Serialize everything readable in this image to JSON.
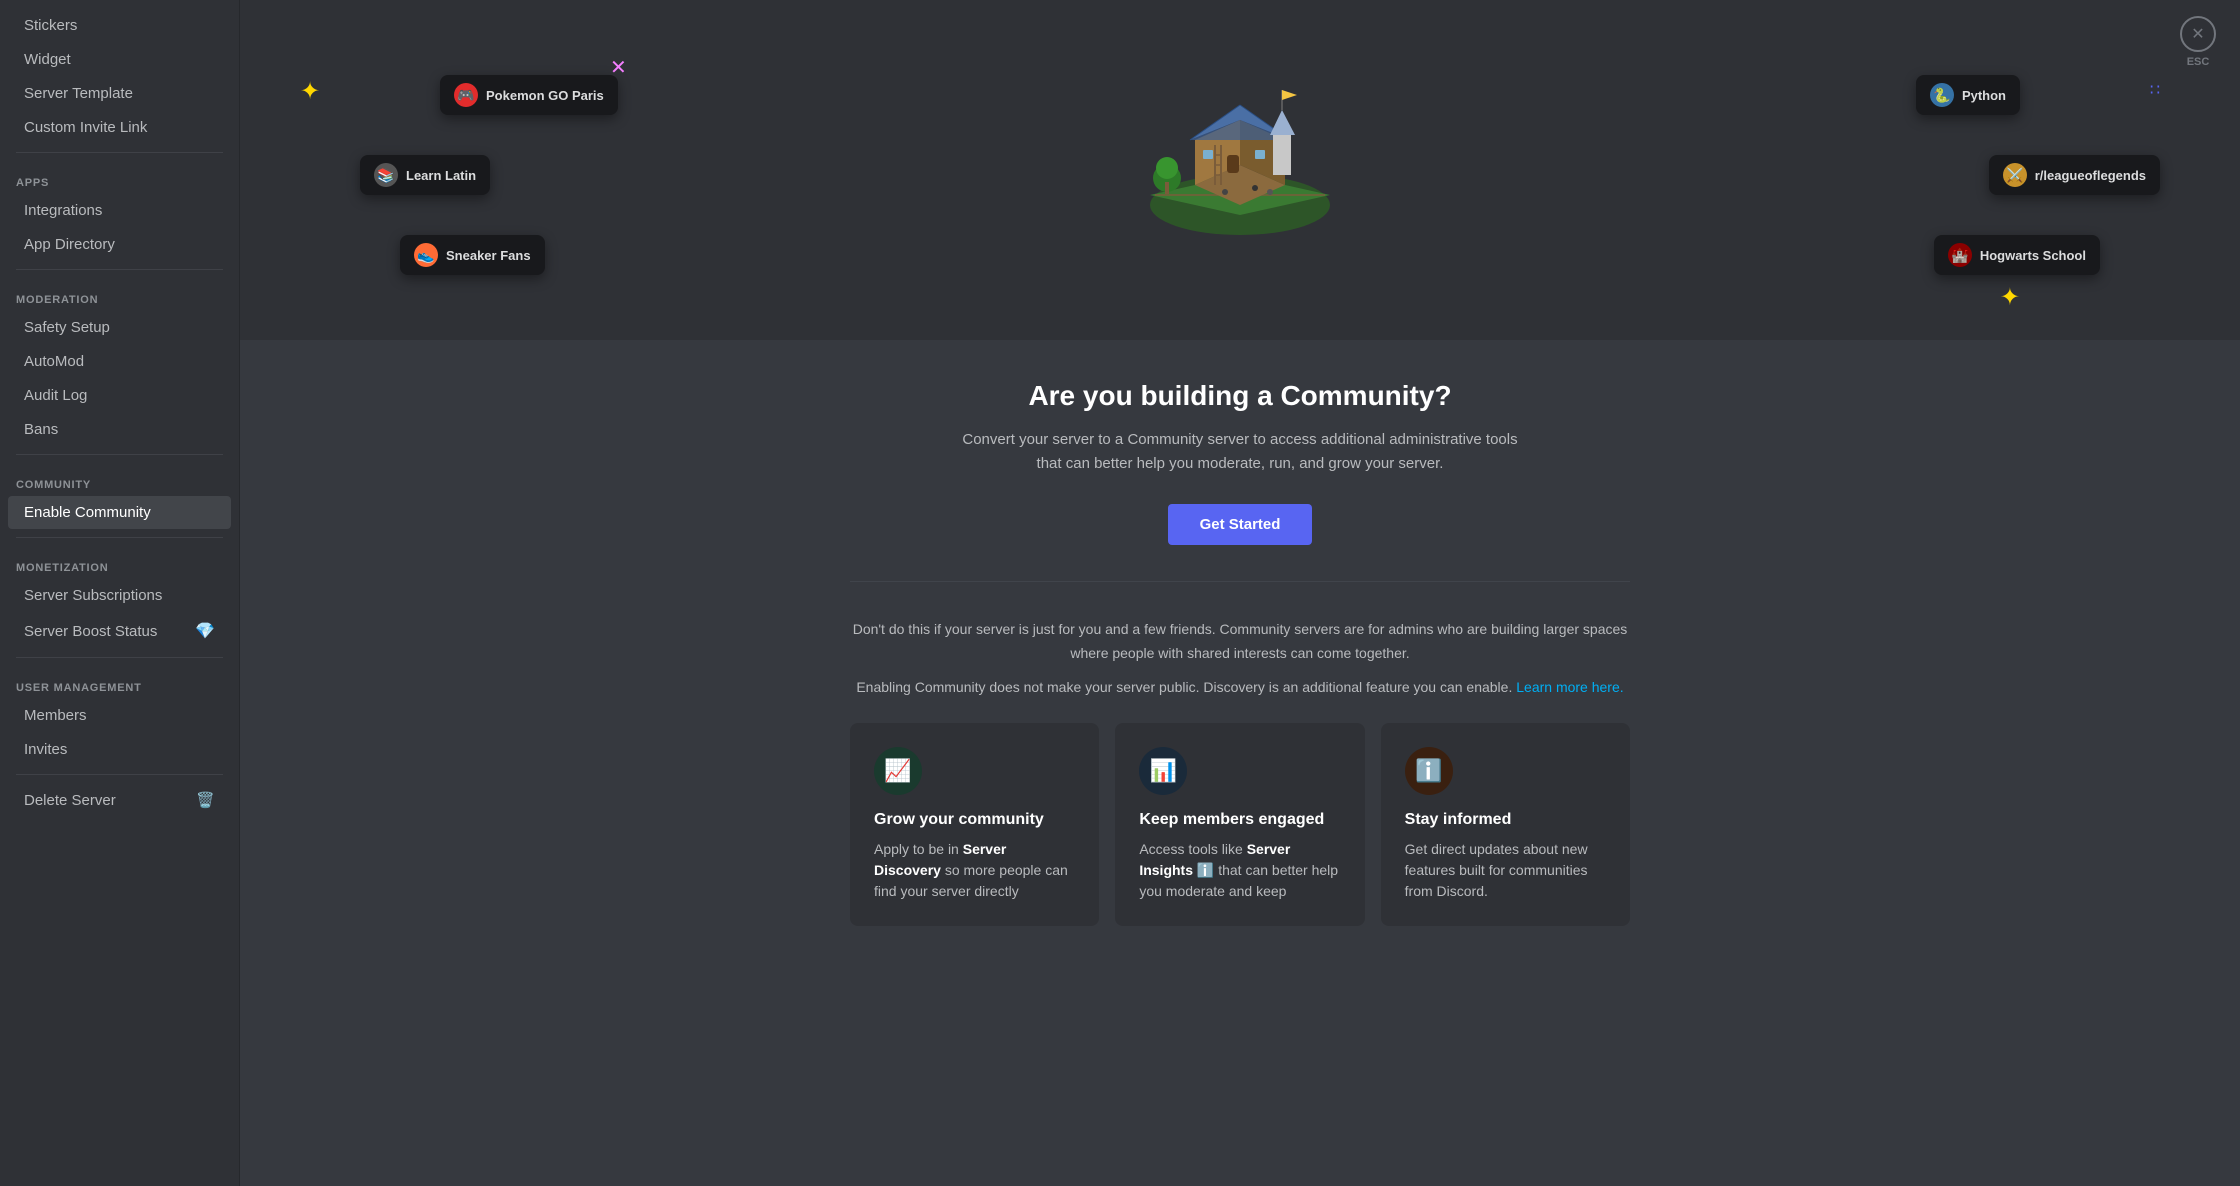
{
  "sidebar": {
    "sections": [
      {
        "items": [
          {
            "id": "stickers",
            "label": "Stickers",
            "active": false,
            "icon": null
          },
          {
            "id": "widget",
            "label": "Widget",
            "active": false,
            "icon": null
          },
          {
            "id": "server-template",
            "label": "Server Template",
            "active": false,
            "icon": null
          },
          {
            "id": "custom-invite-link",
            "label": "Custom Invite Link",
            "active": false,
            "icon": null
          }
        ]
      },
      {
        "header": "APPS",
        "items": [
          {
            "id": "integrations",
            "label": "Integrations",
            "active": false,
            "icon": null
          },
          {
            "id": "app-directory",
            "label": "App Directory",
            "active": false,
            "icon": null
          }
        ]
      },
      {
        "header": "MODERATION",
        "items": [
          {
            "id": "safety-setup",
            "label": "Safety Setup",
            "active": false,
            "icon": null
          },
          {
            "id": "automod",
            "label": "AutoMod",
            "active": false,
            "icon": null
          },
          {
            "id": "audit-log",
            "label": "Audit Log",
            "active": false,
            "icon": null
          },
          {
            "id": "bans",
            "label": "Bans",
            "active": false,
            "icon": null
          }
        ]
      },
      {
        "header": "COMMUNITY",
        "items": [
          {
            "id": "enable-community",
            "label": "Enable Community",
            "active": true,
            "icon": null
          }
        ]
      },
      {
        "header": "MONETIZATION",
        "items": [
          {
            "id": "server-subscriptions",
            "label": "Server Subscriptions",
            "active": false,
            "icon": null
          },
          {
            "id": "server-boost-status",
            "label": "Server Boost Status",
            "active": false,
            "icon": "💎"
          }
        ]
      },
      {
        "header": "USER MANAGEMENT",
        "items": [
          {
            "id": "members",
            "label": "Members",
            "active": false,
            "icon": null
          },
          {
            "id": "invites",
            "label": "Invites",
            "active": false,
            "icon": null
          }
        ]
      },
      {
        "items": [
          {
            "id": "delete-server",
            "label": "Delete Server",
            "active": false,
            "icon": "🗑️"
          }
        ]
      }
    ]
  },
  "hero": {
    "badges": [
      {
        "id": "pokemon",
        "label": "Pokemon GO Paris",
        "bg": "#e22c2c",
        "emoji": "🎮"
      },
      {
        "id": "learn-latin",
        "label": "Learn Latin",
        "bg": "#555",
        "emoji": "📚"
      },
      {
        "id": "sneaker-fans",
        "label": "Sneaker Fans",
        "bg": "#ff6b35",
        "emoji": "👟"
      },
      {
        "id": "python",
        "label": "Python",
        "bg": "#3572a5",
        "emoji": "🐍"
      },
      {
        "id": "league",
        "label": "r/leagueoflegends",
        "bg": "#c8922a",
        "emoji": "⚔️"
      },
      {
        "id": "hogwarts",
        "label": "Hogwarts School",
        "bg": "#8b0000",
        "emoji": "🏰"
      }
    ],
    "esc_label": "ESC"
  },
  "main": {
    "title": "Are you building a Community?",
    "subtitle": "Convert your server to a Community server to access additional administrative tools that can better help you moderate, run, and grow your server.",
    "get_started_label": "Get Started",
    "info1": "Don't do this if your server is just for you and a few friends. Community servers are for admins who are building larger spaces where people with shared interests can come together.",
    "info2_prefix": "Enabling Community does not make your server public. Discovery is an additional feature you can enable.",
    "info2_link": "Learn more here.",
    "features": [
      {
        "id": "grow",
        "icon": "📈",
        "icon_class": "icon-green",
        "title": "Grow your community",
        "desc_prefix": "Apply to be in ",
        "desc_bold": "Server Discovery",
        "desc_suffix": " so more people can find your server directly"
      },
      {
        "id": "engaged",
        "icon": "📊",
        "icon_class": "icon-blue",
        "title": "Keep members engaged",
        "desc_prefix": "Access tools like ",
        "desc_bold": "Server Insights",
        "desc_suffix": " ℹ️ that can better help you moderate and keep"
      },
      {
        "id": "informed",
        "icon": "ℹ️",
        "icon_class": "icon-orange",
        "title": "Stay informed",
        "desc": "Get direct updates about new features built for communities from Discord."
      }
    ]
  }
}
